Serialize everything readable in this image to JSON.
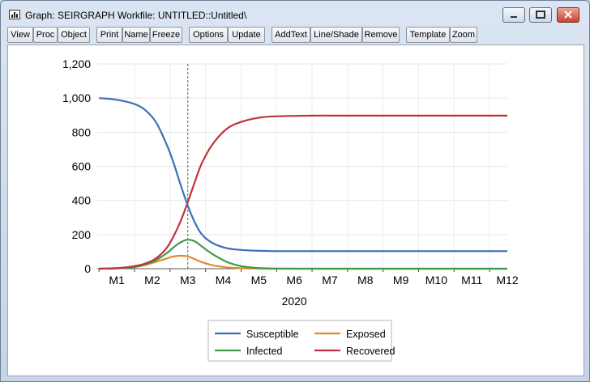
{
  "window": {
    "title": "Graph: SEIRGRAPH   Workfile: UNTITLED::Untitled\\",
    "controls": [
      "minimize",
      "maximize",
      "close"
    ]
  },
  "toolbar": {
    "buttons": [
      "View",
      "Proc",
      "Object",
      "Print",
      "Name",
      "Freeze",
      "Options",
      "Update",
      "AddText",
      "Line/Shade",
      "Remove",
      "Template",
      "Zoom"
    ]
  },
  "colors": {
    "susceptible": "#3d6fb5",
    "exposed": "#e08a2e",
    "infected": "#3c9a4b",
    "recovered": "#c0323b",
    "vline": "#2e7d32"
  },
  "chart_data": {
    "type": "line",
    "xlabel": "2020",
    "ylim": [
      0,
      1200
    ],
    "yticks": [
      "0",
      "200",
      "400",
      "600",
      "800",
      "1,000",
      "1,200"
    ],
    "ytick_values": [
      0,
      200,
      400,
      600,
      800,
      1000,
      1200
    ],
    "x_categories": [
      "M1",
      "M2",
      "M3",
      "M4",
      "M5",
      "M6",
      "M7",
      "M8",
      "M9",
      "M10",
      "M11",
      "M12"
    ],
    "vertical_line_month": 3.5,
    "grid": true,
    "legend": "bottom",
    "series": [
      {
        "name": "Susceptible",
        "color_key": "susceptible",
        "x": [
          1.0,
          1.5,
          2.0,
          2.3,
          2.6,
          2.9,
          3.1,
          3.3,
          3.5,
          3.7,
          3.9,
          4.2,
          4.6,
          5.0,
          5.5,
          6.0,
          7.0,
          8.0,
          9.0,
          10.0,
          11.0,
          12.0,
          12.5
        ],
        "y": [
          1000,
          990,
          965,
          930,
          860,
          730,
          620,
          490,
          370,
          270,
          200,
          150,
          120,
          110,
          105,
          103,
          103,
          103,
          103,
          103,
          103,
          103,
          103
        ]
      },
      {
        "name": "Exposed",
        "color_key": "exposed",
        "x": [
          1.0,
          1.5,
          2.0,
          2.3,
          2.6,
          2.9,
          3.1,
          3.3,
          3.5,
          3.7,
          3.9,
          4.2,
          4.6,
          5.0,
          5.5,
          6.0,
          7.0,
          8.0,
          9.0,
          10.0,
          11.0,
          12.0,
          12.5
        ],
        "y": [
          0,
          3,
          10,
          22,
          40,
          60,
          72,
          76,
          72,
          55,
          38,
          20,
          8,
          3,
          1,
          0,
          0,
          0,
          0,
          0,
          0,
          0,
          0
        ]
      },
      {
        "name": "Infected",
        "color_key": "infected",
        "x": [
          1.0,
          1.5,
          2.0,
          2.3,
          2.6,
          2.9,
          3.1,
          3.3,
          3.5,
          3.7,
          3.9,
          4.2,
          4.6,
          5.0,
          5.5,
          6.0,
          7.0,
          8.0,
          9.0,
          10.0,
          11.0,
          12.0,
          12.5
        ],
        "y": [
          0,
          2,
          10,
          25,
          50,
          90,
          125,
          155,
          170,
          160,
          130,
          85,
          40,
          15,
          4,
          1,
          0,
          0,
          0,
          0,
          0,
          0,
          0
        ]
      },
      {
        "name": "Recovered",
        "color_key": "recovered",
        "x": [
          1.0,
          1.5,
          2.0,
          2.3,
          2.6,
          2.9,
          3.1,
          3.3,
          3.5,
          3.7,
          3.9,
          4.2,
          4.6,
          5.0,
          5.5,
          6.0,
          7.0,
          8.0,
          9.0,
          10.0,
          11.0,
          12.0,
          12.5
        ],
        "y": [
          0,
          3,
          15,
          30,
          60,
          120,
          190,
          280,
          390,
          510,
          620,
          730,
          820,
          860,
          885,
          893,
          897,
          897,
          897,
          897,
          897,
          897,
          897
        ]
      }
    ]
  }
}
